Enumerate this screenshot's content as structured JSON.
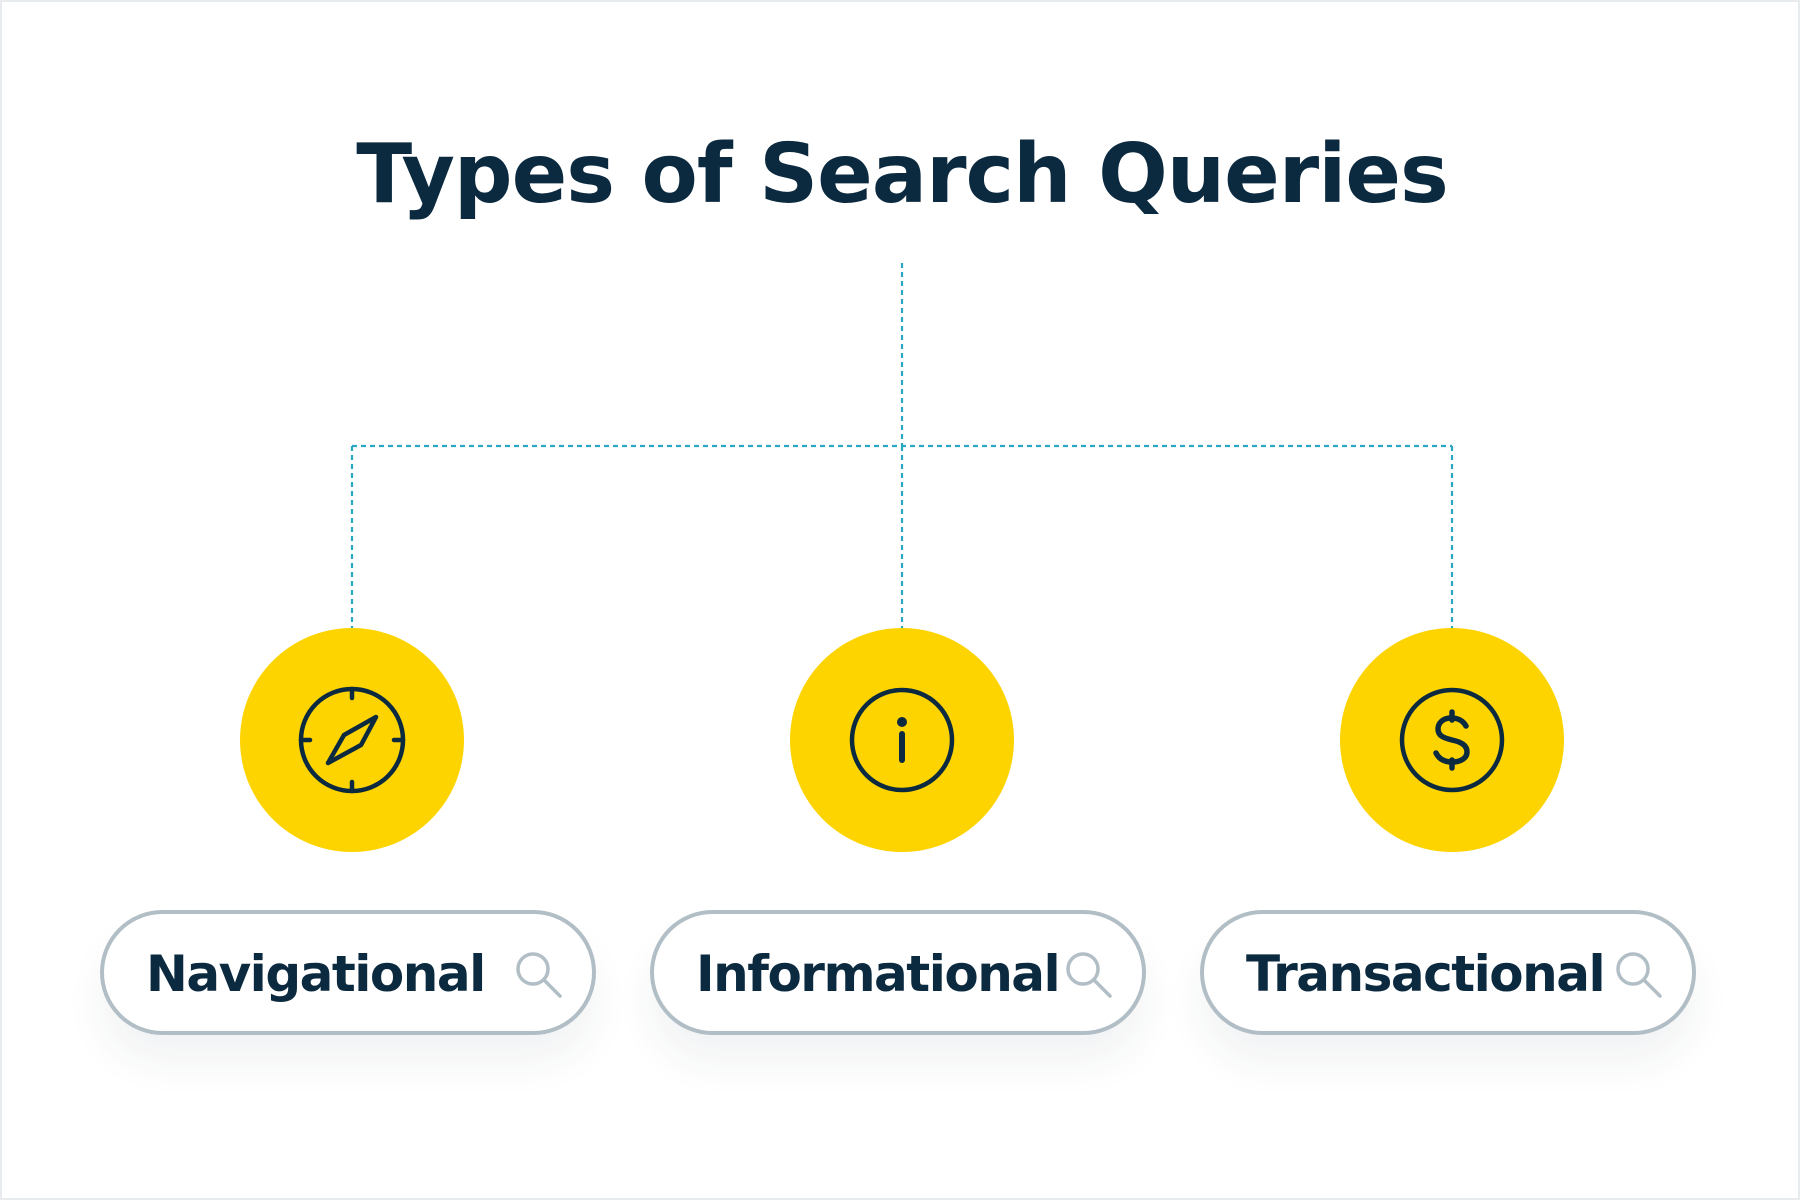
{
  "title": "Types of Search Queries",
  "colors": {
    "title_text": "#0c2a3f",
    "connector": "#2aa7c2",
    "node_fill": "#fdd400",
    "icon_stroke": "#0c2a3f",
    "pill_border": "#b2bec6",
    "search_icon": "#b2bec6"
  },
  "categories": [
    {
      "label": "Navigational",
      "icon": "compass-icon"
    },
    {
      "label": "Informational",
      "icon": "info-icon"
    },
    {
      "label": "Transactional",
      "icon": "dollar-icon"
    }
  ],
  "search_icon": "search-icon"
}
